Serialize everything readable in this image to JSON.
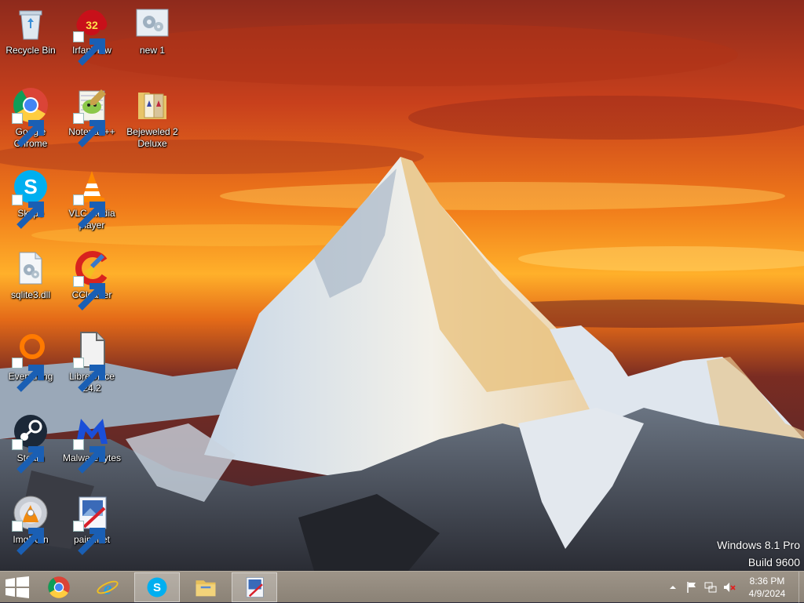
{
  "desktop": {
    "icons": [
      {
        "label": "Recycle Bin",
        "icon": "recycle-bin-icon",
        "shortcut": false
      },
      {
        "label": "IrfanView",
        "icon": "irfanview-icon",
        "shortcut": true,
        "badge": "32"
      },
      {
        "label": "new 1",
        "icon": "config-file-icon",
        "shortcut": false
      },
      {
        "label": "Google Chrome",
        "icon": "chrome-icon",
        "shortcut": true
      },
      {
        "label": "Notepad++",
        "icon": "notepadpp-icon",
        "shortcut": true
      },
      {
        "label": "Bejeweled 2 Deluxe",
        "icon": "folder-icon",
        "shortcut": false
      },
      {
        "label": "Skype",
        "icon": "skype-icon",
        "shortcut": true
      },
      {
        "label": "VLC media player",
        "icon": "vlc-icon",
        "shortcut": true
      },
      {
        "label": "sqlite3.dll",
        "icon": "dll-file-icon",
        "shortcut": false
      },
      {
        "label": "CCleaner",
        "icon": "ccleaner-icon",
        "shortcut": true
      },
      {
        "label": "Everything",
        "icon": "everything-icon",
        "shortcut": true
      },
      {
        "label": "LibreOffice 24.2",
        "icon": "libreoffice-icon",
        "shortcut": true
      },
      {
        "label": "Steam",
        "icon": "steam-icon",
        "shortcut": true
      },
      {
        "label": "Malwarebytes",
        "icon": "malwarebytes-icon",
        "shortcut": true
      },
      {
        "label": "ImgBurn",
        "icon": "imgburn-icon",
        "shortcut": true
      },
      {
        "label": "paint.net",
        "icon": "paintnet-icon",
        "shortcut": true
      }
    ]
  },
  "watermark": {
    "line1": "Windows 8.1 Pro",
    "line2": "Build 9600"
  },
  "taskbar": {
    "start": "windows-start-icon",
    "pinned": [
      {
        "name": "chrome",
        "icon": "chrome-icon",
        "active": false
      },
      {
        "name": "internet-explorer",
        "icon": "internet-explorer-icon",
        "active": false
      },
      {
        "name": "skype",
        "icon": "skype-icon",
        "active": true
      },
      {
        "name": "file-explorer",
        "icon": "file-explorer-icon",
        "active": false
      },
      {
        "name": "paint-net",
        "icon": "paintnet-icon",
        "active": true
      }
    ],
    "tray": {
      "icons": [
        "show-hidden-icons-chevron-icon",
        "action-center-flag-icon",
        "network-icon",
        "volume-muted-icon"
      ],
      "time": "8:36 PM",
      "date": "4/9/2024"
    }
  },
  "colors": {
    "sky_top": "#c8401c",
    "sky_mid": "#f07a1a",
    "sky_glow": "#ffc23a",
    "taskbar": "#958c80",
    "skype_blue": "#00aff0"
  }
}
